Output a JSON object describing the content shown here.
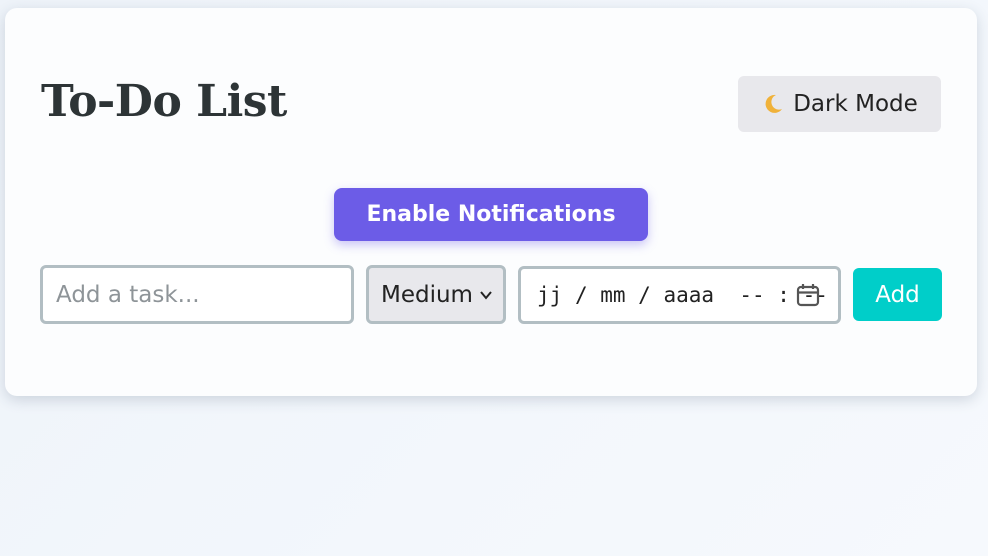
{
  "app": {
    "title": "To-Do List"
  },
  "theme_toggle": {
    "icon": "crescent-moon-icon",
    "label": "Dark Mode"
  },
  "notifications": {
    "label": "Enable Notifications",
    "color": "#6c5ce7"
  },
  "task_form": {
    "task_input": {
      "value": "",
      "placeholder": "Add a task..."
    },
    "priority": {
      "selected": "Medium"
    },
    "due": {
      "day": "jj",
      "month": "mm",
      "year": "aaaa",
      "hour": "--",
      "minute": "--",
      "icon": "calendar-icon"
    },
    "add_label": "Add",
    "add_color": "#00cec9"
  }
}
